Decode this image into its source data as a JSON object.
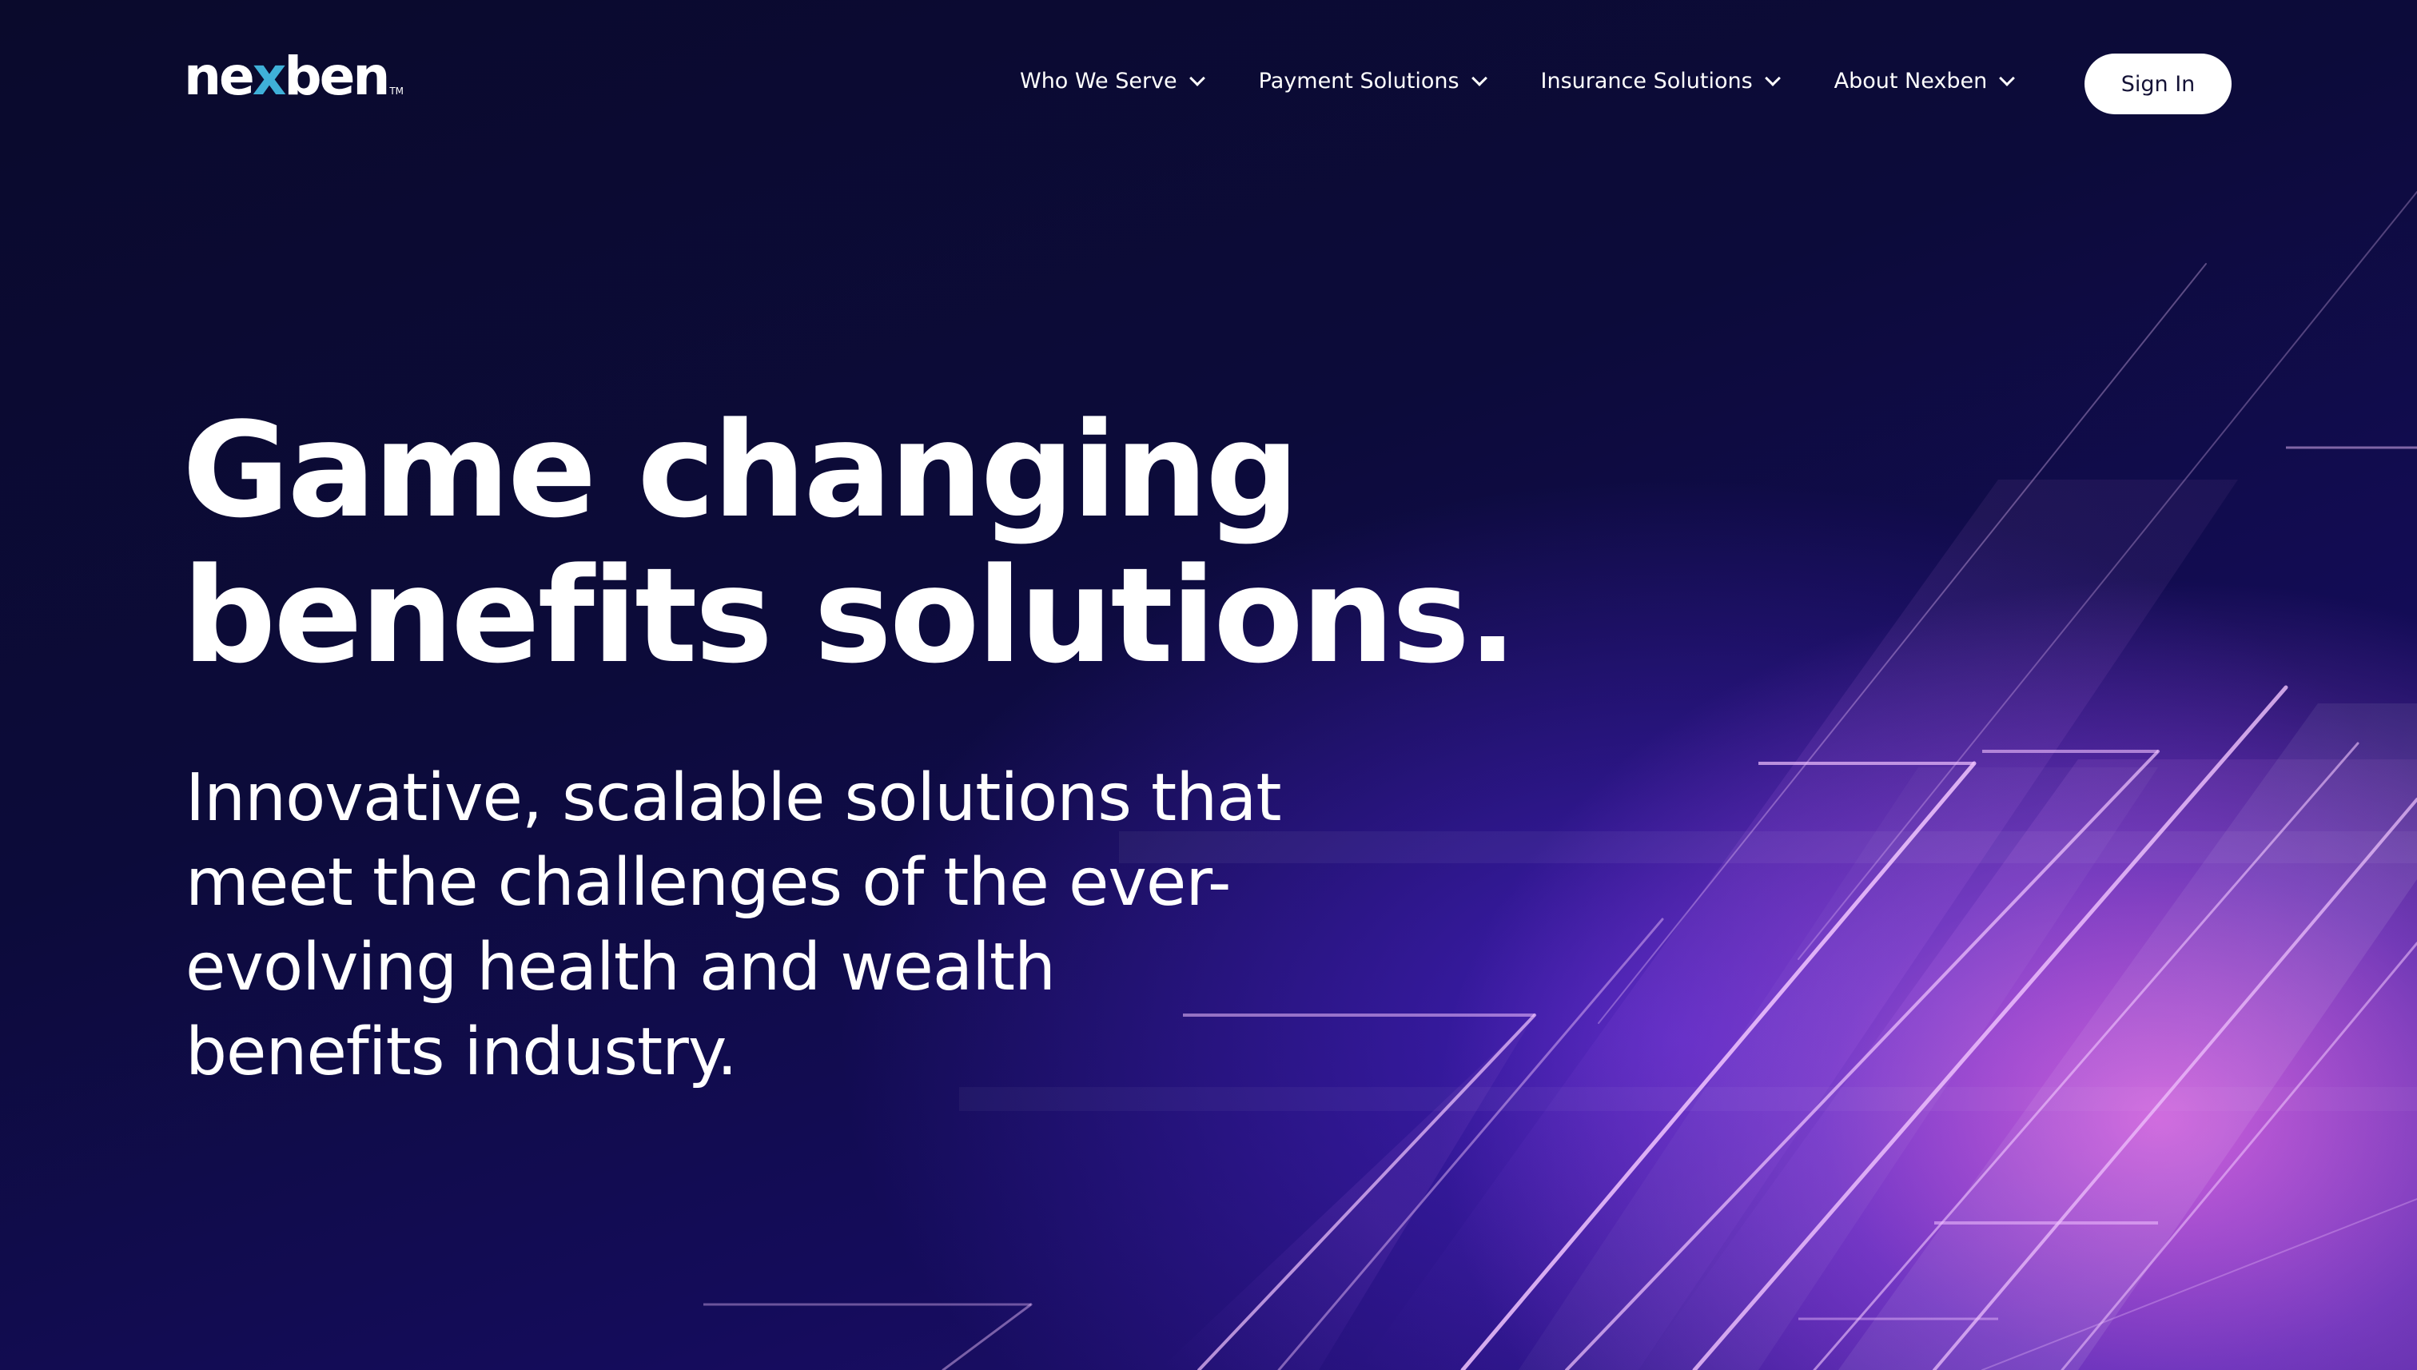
{
  "brand": {
    "logo_prefix": "ne",
    "logo_x": "x",
    "logo_suffix": "ben",
    "logo_tm": "TM",
    "accent_color": "#3fb0d8"
  },
  "nav": {
    "items": [
      {
        "label": "Who We Serve",
        "icon": "chevron-down-icon"
      },
      {
        "label": "Payment Solutions",
        "icon": "chevron-down-icon"
      },
      {
        "label": "Insurance Solutions",
        "icon": "chevron-down-icon"
      },
      {
        "label": "About Nexben",
        "icon": "chevron-down-icon"
      }
    ],
    "sign_in_label": "Sign In"
  },
  "hero": {
    "headline_lines": [
      "Game changing",
      "benefits solutions."
    ],
    "subhead_lines": [
      "Innovative, scalable solutions that",
      "meet the challenges of the ever-",
      "evolving health and wealth",
      "benefits industry."
    ],
    "background_colors": {
      "dark": "#0b0a33",
      "violet": "#5a28e6",
      "magenta": "#d660dc"
    }
  }
}
